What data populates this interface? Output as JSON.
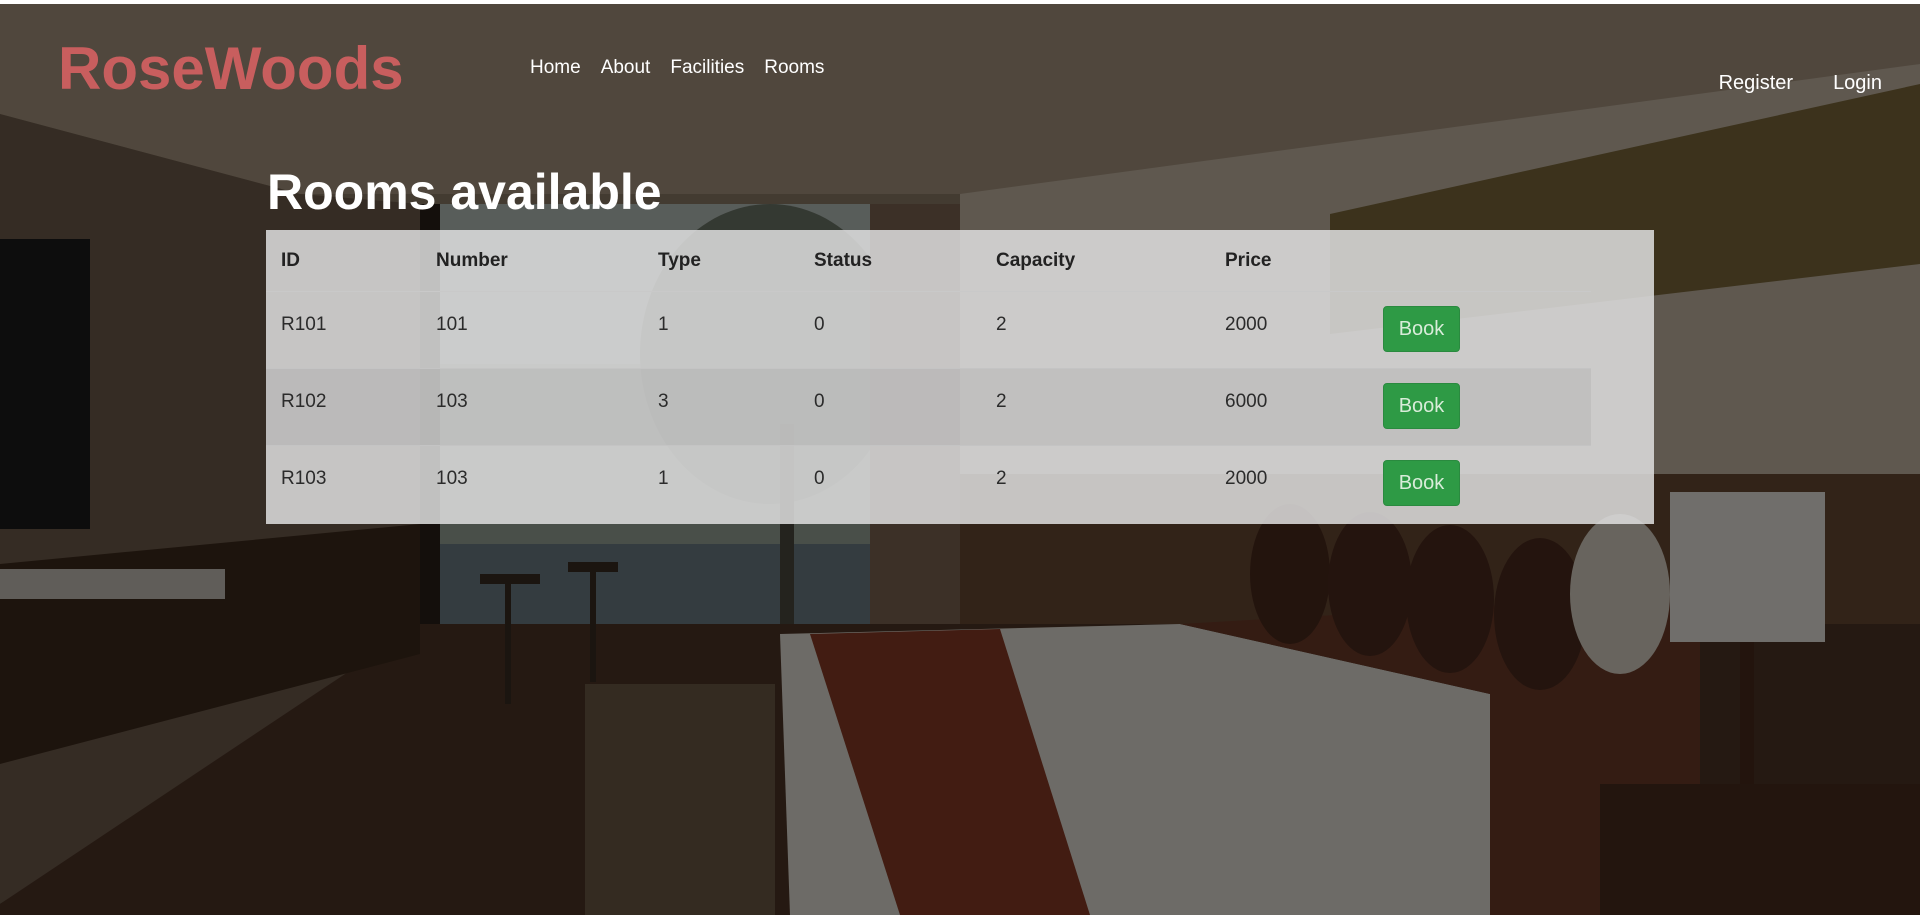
{
  "header": {
    "brand": "RoseWoods",
    "nav": [
      "Home",
      "About",
      "Facilities",
      "Rooms"
    ],
    "auth": [
      "Register",
      "Login"
    ]
  },
  "main": {
    "title": "Rooms available",
    "columns": [
      "ID",
      "Number",
      "Type",
      "Status",
      "Capacity",
      "Price",
      ""
    ],
    "rows": [
      {
        "id": "R101",
        "number": "101",
        "type": "1",
        "status": "0",
        "capacity": "2",
        "price": "2000",
        "action": "Book"
      },
      {
        "id": "R102",
        "number": "103",
        "type": "3",
        "status": "0",
        "capacity": "2",
        "price": "6000",
        "action": "Book"
      },
      {
        "id": "R103",
        "number": "103",
        "type": "1",
        "status": "0",
        "capacity": "2",
        "price": "2000",
        "action": "Book"
      }
    ]
  },
  "colors": {
    "brand": "#c85e5e",
    "book_button": "#2e9a45",
    "table_panel": "#dedede"
  }
}
